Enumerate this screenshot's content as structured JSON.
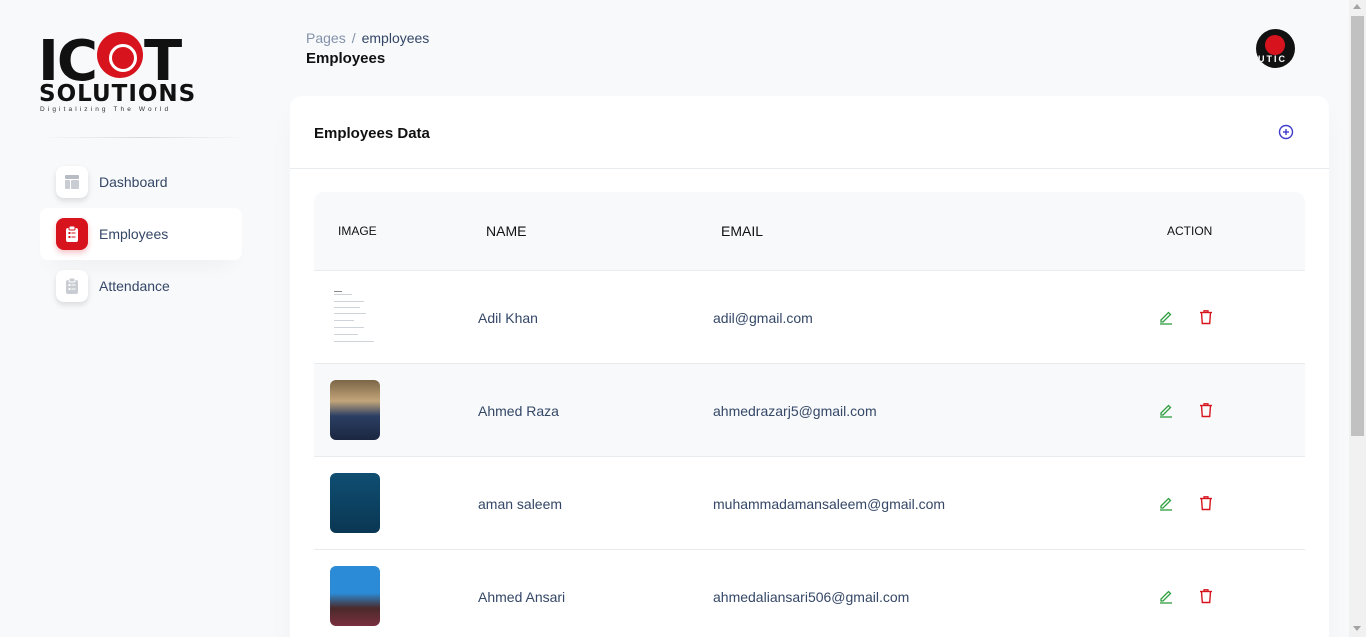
{
  "brand": {
    "logo_main": "ICOT",
    "logo_sub": "SOLUTIONS",
    "tagline": "Digitalizing The World"
  },
  "sidebar": {
    "items": [
      {
        "label": "Dashboard",
        "icon": "dashboard-icon",
        "active": false
      },
      {
        "label": "Employees",
        "icon": "clipboard-list-icon",
        "active": true
      },
      {
        "label": "Attendance",
        "icon": "clipboard-list-icon",
        "active": false
      }
    ]
  },
  "header": {
    "breadcrumb_root": "Pages",
    "breadcrumb_separator": "/",
    "breadcrumb_current": "employees",
    "title": "Employees",
    "avatar_text": "UTIC"
  },
  "card": {
    "title": "Employees Data",
    "add_icon": "plus-circle-icon"
  },
  "table": {
    "columns": [
      "IMAGE",
      "NAME",
      "EMAIL",
      "ACTION"
    ],
    "rows": [
      {
        "name": "Adil Khan",
        "email": "adil@gmail.com"
      },
      {
        "name": "Ahmed Raza",
        "email": "ahmedrazarj5@gmail.com"
      },
      {
        "name": "aman saleem",
        "email": "muhammadamansaleem@gmail.com"
      },
      {
        "name": "Ahmed Ansari",
        "email": "ahmedaliansari506@gmail.com"
      }
    ]
  },
  "colors": {
    "accent_red": "#d7141e",
    "edit_green": "#2e9e3e",
    "add_blue": "#3f3dc9"
  }
}
